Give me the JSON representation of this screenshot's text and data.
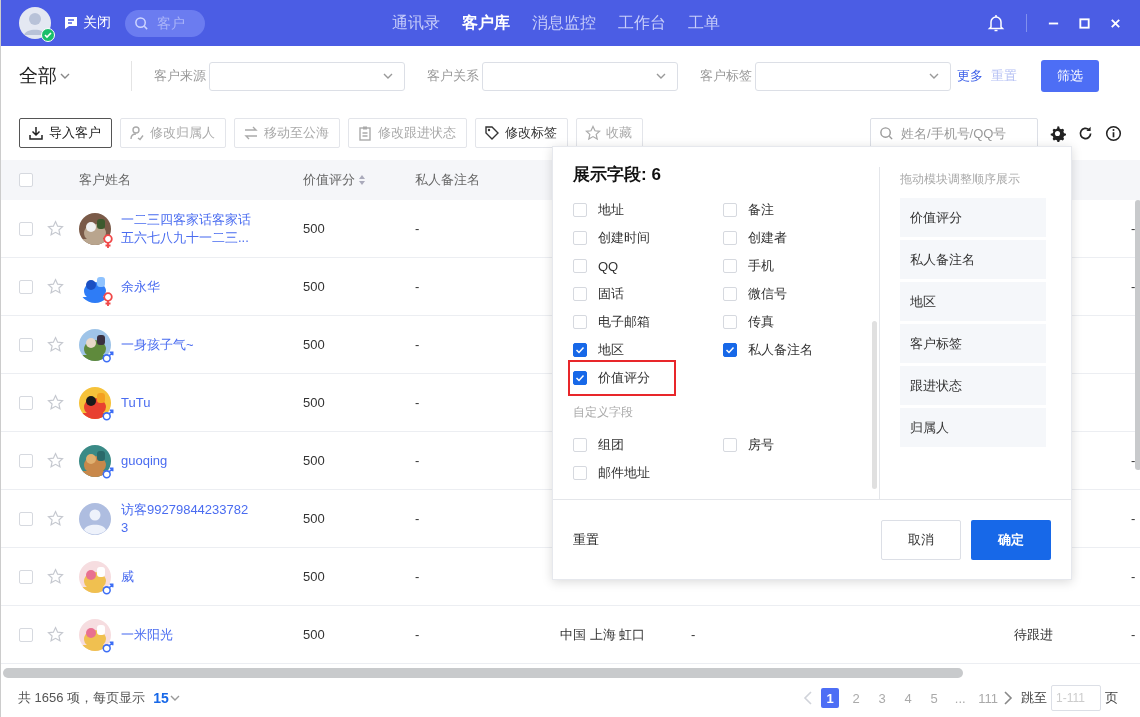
{
  "topbar": {
    "close_label": "关闭",
    "search_placeholder": "客户",
    "nav": [
      {
        "label": "通讯录",
        "selected": false
      },
      {
        "label": "客户库",
        "selected": true
      },
      {
        "label": "消息监控",
        "selected": false
      },
      {
        "label": "工作台",
        "selected": false
      },
      {
        "label": "工单",
        "selected": false
      }
    ]
  },
  "filters": {
    "scope": "全部",
    "fields": [
      {
        "label": "客户来源"
      },
      {
        "label": "客户关系"
      },
      {
        "label": "客户标签"
      }
    ],
    "more": "更多",
    "reset": "重置",
    "submit": "筛选"
  },
  "toolbar": {
    "actions": [
      {
        "label": "导入客户",
        "disabled": false
      },
      {
        "label": "修改归属人",
        "disabled": true
      },
      {
        "label": "移动至公海",
        "disabled": true
      },
      {
        "label": "修改跟进状态",
        "disabled": true
      },
      {
        "label": "修改标签",
        "disabled": false
      },
      {
        "label": "收藏",
        "disabled": true
      }
    ],
    "search_placeholder": "姓名/手机号/QQ号"
  },
  "table": {
    "select_all": false,
    "columns": [
      {
        "label": "客户姓名",
        "sortable": false
      },
      {
        "label": "价值评分",
        "sortable": true
      },
      {
        "label": "私人备注名",
        "sortable": false
      }
    ],
    "rows": [
      {
        "checked": false,
        "favorite": false,
        "kind": "female",
        "name": "一二三四客家话客家话五六七八九十一二三...",
        "score": "500",
        "note": "-",
        "last": "-"
      },
      {
        "checked": false,
        "favorite": false,
        "kind": "female",
        "name": "余永华",
        "score": "500",
        "note": "-",
        "last": "-"
      },
      {
        "checked": false,
        "favorite": false,
        "kind": "male",
        "name": "一身孩子气~",
        "score": "500",
        "note": "-"
      },
      {
        "checked": false,
        "favorite": false,
        "kind": "male",
        "name": "TuTu",
        "score": "500",
        "note": "-"
      },
      {
        "checked": false,
        "favorite": false,
        "kind": "male",
        "name": "guoqing",
        "score": "500",
        "note": "-",
        "last": "-"
      },
      {
        "checked": false,
        "favorite": false,
        "kind": "visitor",
        "name": "访客992798442337823",
        "score": "500",
        "note": "-",
        "last": "-"
      },
      {
        "checked": false,
        "favorite": false,
        "kind": "male",
        "name": "威",
        "score": "500",
        "note": "-",
        "last": "-"
      },
      {
        "checked": false,
        "favorite": false,
        "kind": "male",
        "name": "一米阳光",
        "score": "500",
        "note": "-",
        "region": "中国 上海 虹口",
        "column_7": "-",
        "status": "待跟进",
        "last": "-"
      }
    ]
  },
  "field_picker": {
    "title": "展示字段: 6",
    "fields": [
      {
        "label": "地址",
        "checked": false,
        "highlighted": false
      },
      {
        "label": "备注",
        "checked": false,
        "highlighted": false
      },
      {
        "label": "创建时间",
        "checked": false,
        "highlighted": false
      },
      {
        "label": "创建者",
        "checked": false,
        "highlighted": false
      },
      {
        "label": "QQ",
        "checked": false,
        "highlighted": false
      },
      {
        "label": "手机",
        "checked": false,
        "highlighted": false
      },
      {
        "label": "固话",
        "checked": false,
        "highlighted": false
      },
      {
        "label": "微信号",
        "checked": false,
        "highlighted": false
      },
      {
        "label": "电子邮箱",
        "checked": false,
        "highlighted": false
      },
      {
        "label": "传真",
        "checked": false,
        "highlighted": false
      },
      {
        "label": "地区",
        "checked": true,
        "highlighted": false
      },
      {
        "label": "私人备注名",
        "checked": true,
        "highlighted": false
      },
      {
        "label": "价值评分",
        "checked": true,
        "highlighted": true
      }
    ],
    "custom_title": "自定义字段",
    "custom_fields": [
      {
        "label": "组团",
        "checked": false,
        "highlighted": false
      },
      {
        "label": "房号",
        "checked": false,
        "highlighted": false
      },
      {
        "label": "邮件地址",
        "checked": false,
        "highlighted": false
      }
    ],
    "order_hint": "拖动模块调整顺序展示",
    "order": [
      "价值评分",
      "私人备注名",
      "地区",
      "客户标签",
      "跟进状态",
      "归属人"
    ],
    "reset": "重置",
    "cancel": "取消",
    "confirm": "确定"
  },
  "footer": {
    "total": "共 1656 项，每页显示",
    "page_size": "15",
    "pages": [
      {
        "label": "1",
        "selected": true
      },
      {
        "label": "2",
        "selected": false
      },
      {
        "label": "3",
        "selected": false
      },
      {
        "label": "4",
        "selected": false
      },
      {
        "label": "5",
        "selected": false
      },
      {
        "label": "...",
        "selected": false
      },
      {
        "label": "111",
        "selected": false
      }
    ],
    "jump_label": "跳至",
    "jump_placeholder": "1-111",
    "page_suffix": "页"
  }
}
